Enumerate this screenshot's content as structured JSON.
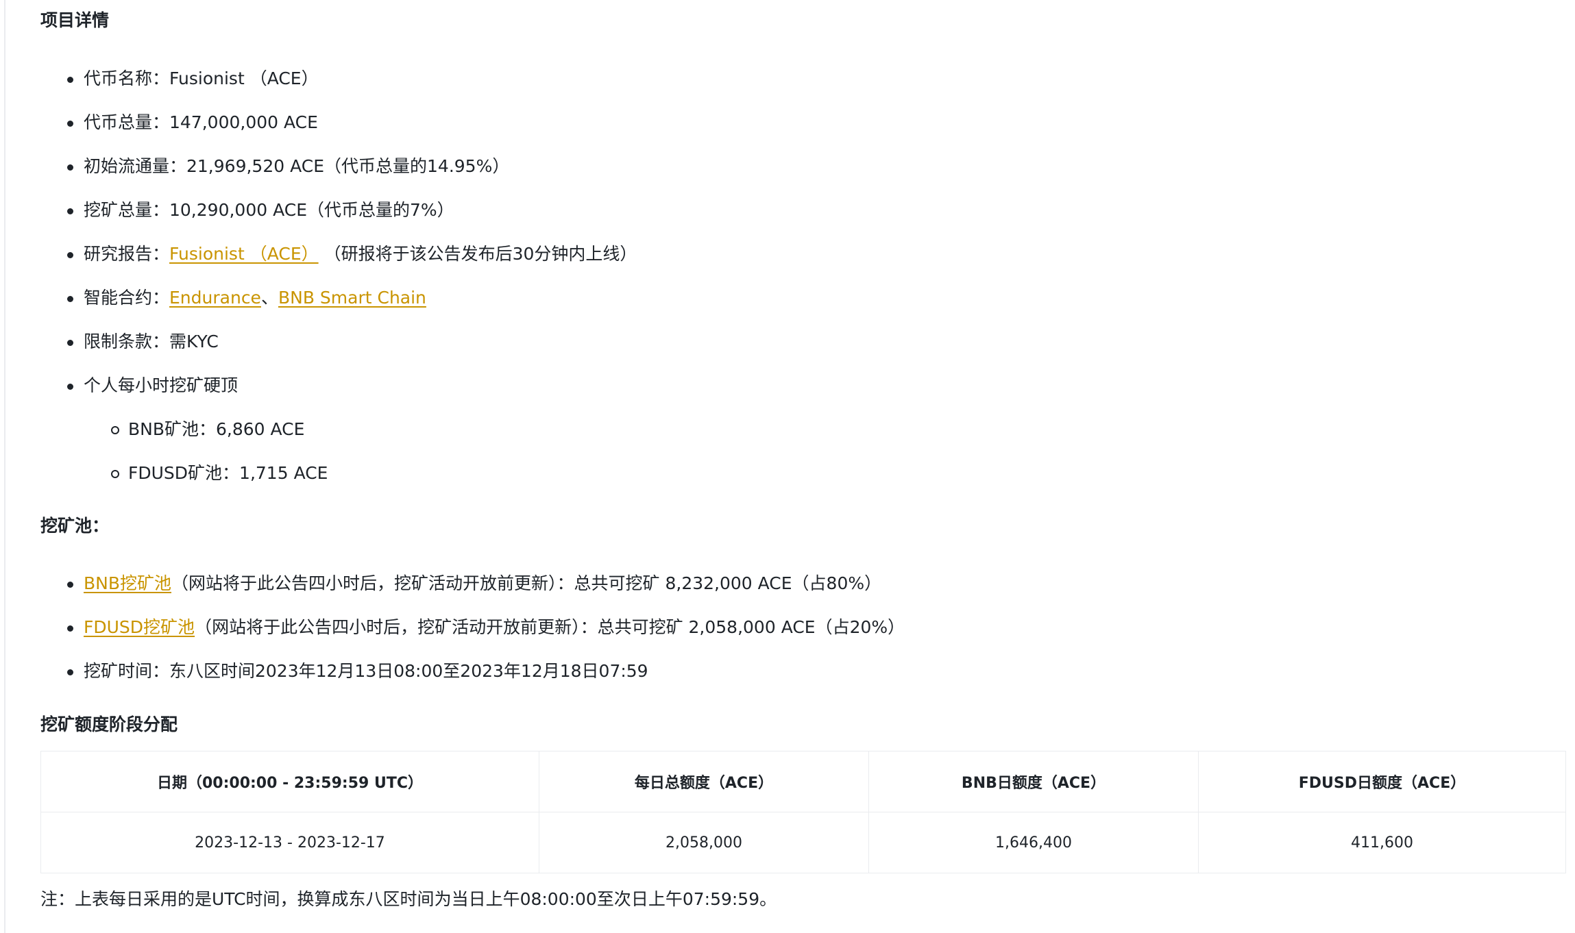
{
  "sections": {
    "project_title": "项目详情",
    "pools_title": "挖矿池：",
    "alloc_title": "挖矿额度阶段分配"
  },
  "details": {
    "token_name": "代币名称：Fusionist （ACE）",
    "total_supply": "代币总量：147,000,000 ACE",
    "initial_circulation": "初始流通量：21,969,520 ACE（代币总量的14.95%）",
    "mining_total": "挖矿总量：10,290,000 ACE（代币总量的7%）",
    "research_prefix": "研究报告：",
    "research_link": "Fusionist （ACE）",
    "research_suffix": " （研报将于该公告发布后30分钟内上线）",
    "contract_prefix": "智能合约：",
    "contract_link_1": "Endurance",
    "contract_sep": "、",
    "contract_link_2": "BNB Smart Chain",
    "restriction": "限制条款：需KYC",
    "hourly_cap": "个人每小时挖矿硬顶",
    "bnb_cap": "BNB矿池：6,860 ACE",
    "fdusd_cap": "FDUSD矿池：1,715 ACE"
  },
  "pools": {
    "bnb_link": "BNB挖矿池",
    "bnb_desc": "（网站将于此公告四小时后，挖矿活动开放前更新）：总共可挖矿 8,232,000 ACE（占80%）",
    "fdusd_link": "FDUSD挖矿池",
    "fdusd_desc": "（网站将于此公告四小时后，挖矿活动开放前更新）：总共可挖矿 2,058,000 ACE（占20%）",
    "mining_time": "挖矿时间：东八区时间2023年12月13日08:00至2023年12月18日07:59"
  },
  "table": {
    "headers": [
      "日期（00:00:00 - 23:59:59 UTC）",
      "每日总额度（ACE）",
      "BNB日额度（ACE）",
      "FDUSD日额度（ACE）"
    ],
    "rows": [
      [
        "2023-12-13 - 2023-12-17",
        "2,058,000",
        "1,646,400",
        "411,600"
      ]
    ]
  },
  "note": "注：上表每日采用的是UTC时间，换算成东八区时间为当日上午08:00:00至次日上午07:59:59。",
  "colors": {
    "text": "#1e2329",
    "link": "#c99400",
    "border": "#eaecef"
  }
}
